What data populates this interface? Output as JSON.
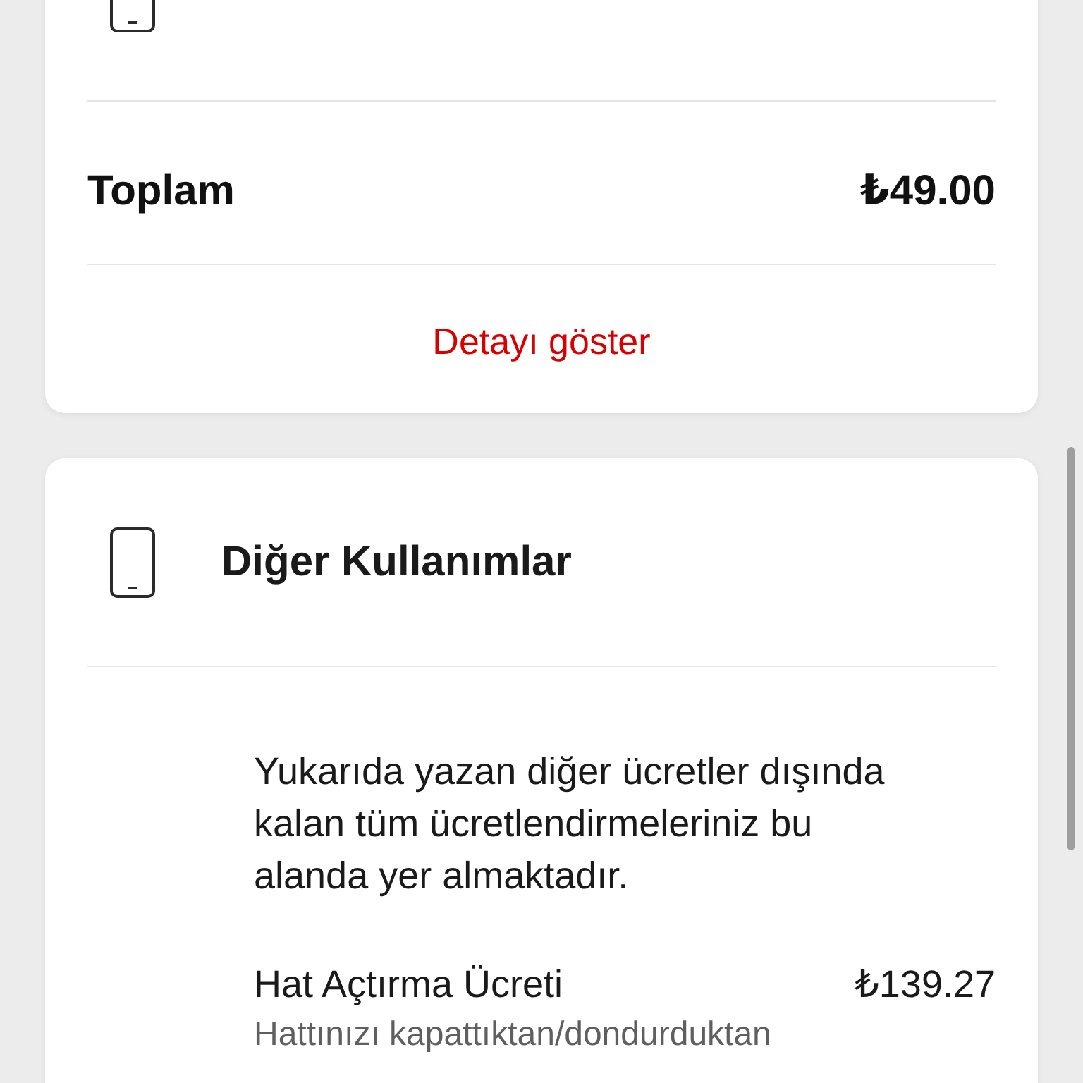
{
  "cards": [
    {
      "kind": "summary",
      "total": {
        "label": "Toplam",
        "amount": "₺49.00"
      },
      "link": "Detayı göster"
    },
    {
      "kind": "details",
      "title": "Diğer Kullanımlar",
      "description": "Yukarıda yazan diğer ücretler dışında kalan tüm ücretlendirmeleriniz bu alanda yer almaktadır.",
      "items": [
        {
          "name": "Hat Açtırma Ücreti",
          "amount": "₺139.27",
          "description": "Hattınızı kapattıktan/dondurduktan"
        }
      ]
    }
  ]
}
